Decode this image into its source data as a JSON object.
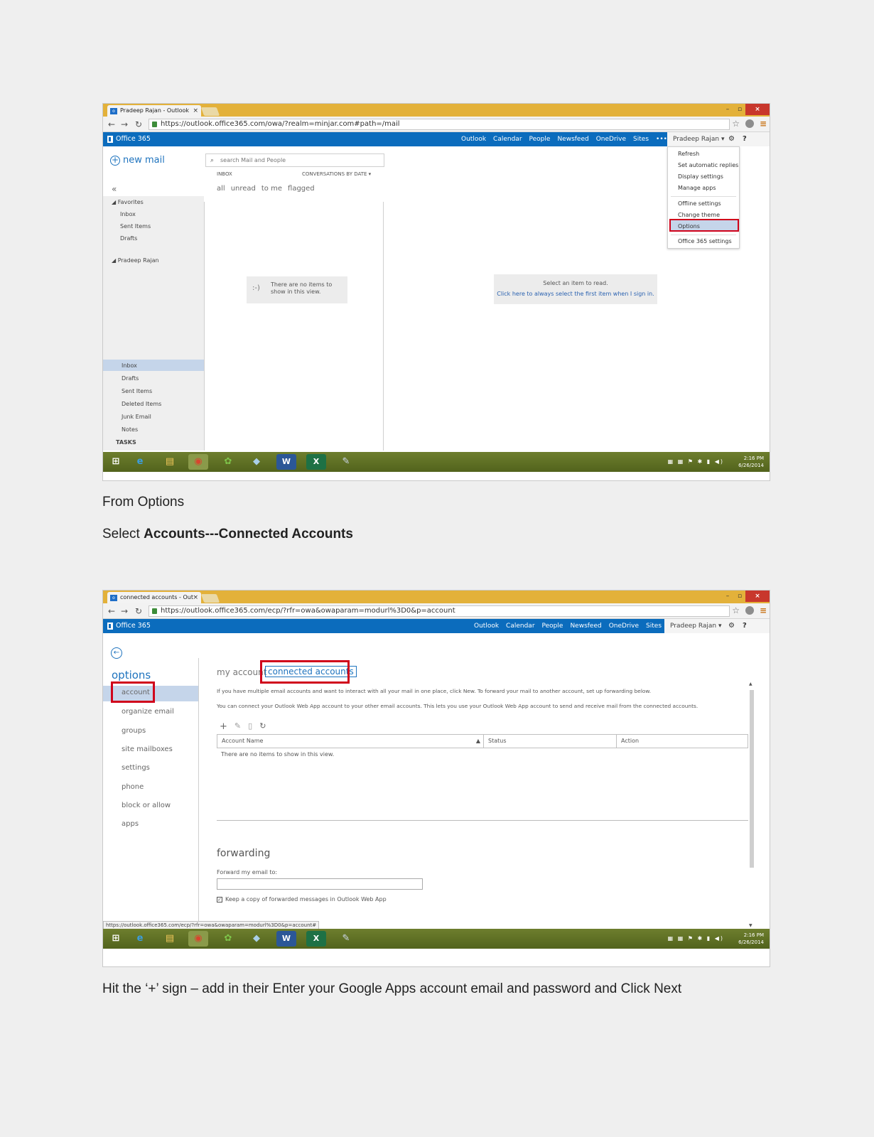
{
  "shot1": {
    "tab_title": "Pradeep Rajan - Outlook",
    "url": "https://outlook.office365.com/owa/?realm=minjar.com#path=/mail",
    "brand": "Office 365",
    "nav": [
      "Outlook",
      "Calendar",
      "People",
      "Newsfeed",
      "OneDrive",
      "Sites",
      "•••"
    ],
    "user": "Pradeep Rajan ▾",
    "new_mail": "new mail",
    "search_placeholder": "search Mail and People",
    "inbox_label": "INBOX",
    "sort_label": "CONVERSATIONS BY DATE",
    "filters": [
      "all",
      "unread",
      "to me",
      "flagged"
    ],
    "favorites_label": "Favorites",
    "favorites": [
      "Inbox",
      "Sent Items",
      "Drafts"
    ],
    "account_label": "Pradeep Rajan",
    "folders": [
      "Inbox",
      "Drafts",
      "Sent Items",
      "Deleted Items",
      "Junk Email",
      "Notes"
    ],
    "tasks_label": "TASKS",
    "no_items": "There are no items to show in this view.",
    "reading_pane_title": "Select an item to read.",
    "reading_pane_link": "Click here to always select the first item when I sign in.",
    "settings_menu": [
      "Refresh",
      "Set automatic replies",
      "Display settings",
      "Manage apps",
      "Offline settings",
      "Change theme",
      "Options",
      "Office 365 settings"
    ],
    "tray_time": "2:16 PM",
    "tray_date": "6/26/2014"
  },
  "caption1": "From Options",
  "caption2_prefix": "Select ",
  "caption2_bold": "Accounts---Connected Accounts",
  "shot2": {
    "tab_title": "connected accounts - Out",
    "url": "https://outlook.office365.com/ecp/?rfr=owa&owaparam=modurl%3D0&p=account",
    "brand": "Office 365",
    "nav": [
      "Outlook",
      "Calendar",
      "People",
      "Newsfeed",
      "OneDrive",
      "Sites",
      "•••"
    ],
    "user": "Pradeep Rajan ▾",
    "options_title": "options",
    "options_nav": [
      "account",
      "organize email",
      "groups",
      "site mailboxes",
      "settings",
      "phone",
      "block or allow",
      "apps"
    ],
    "tab_my_account": "my account",
    "tab_connected": "connected accounts",
    "desc1": "If you have multiple email accounts and want to interact with all your mail in one place, click New. To forward your mail to another account, set up forwarding below.",
    "desc2": "You can connect your Outlook Web App account to your other email accounts. This lets you use your Outlook Web App account to send and receive mail from the connected accounts.",
    "columns": [
      "Account Name",
      "Status",
      "Action"
    ],
    "empty_text": "There are no items to show in this view.",
    "forwarding_title": "forwarding",
    "forward_label": "Forward my email to:",
    "keep_copy": "Keep a copy of forwarded messages in Outlook Web App",
    "status_url": "https://outlook.office365.com/ecp/?rfr=owa&owaparam=modurl%3D0&p=account#",
    "tray_time": "2:16 PM",
    "tray_date": "6/26/2014"
  },
  "caption3": "Hit the ‘+’ sign – add in their Enter your Google Apps account email and password and Click Next"
}
